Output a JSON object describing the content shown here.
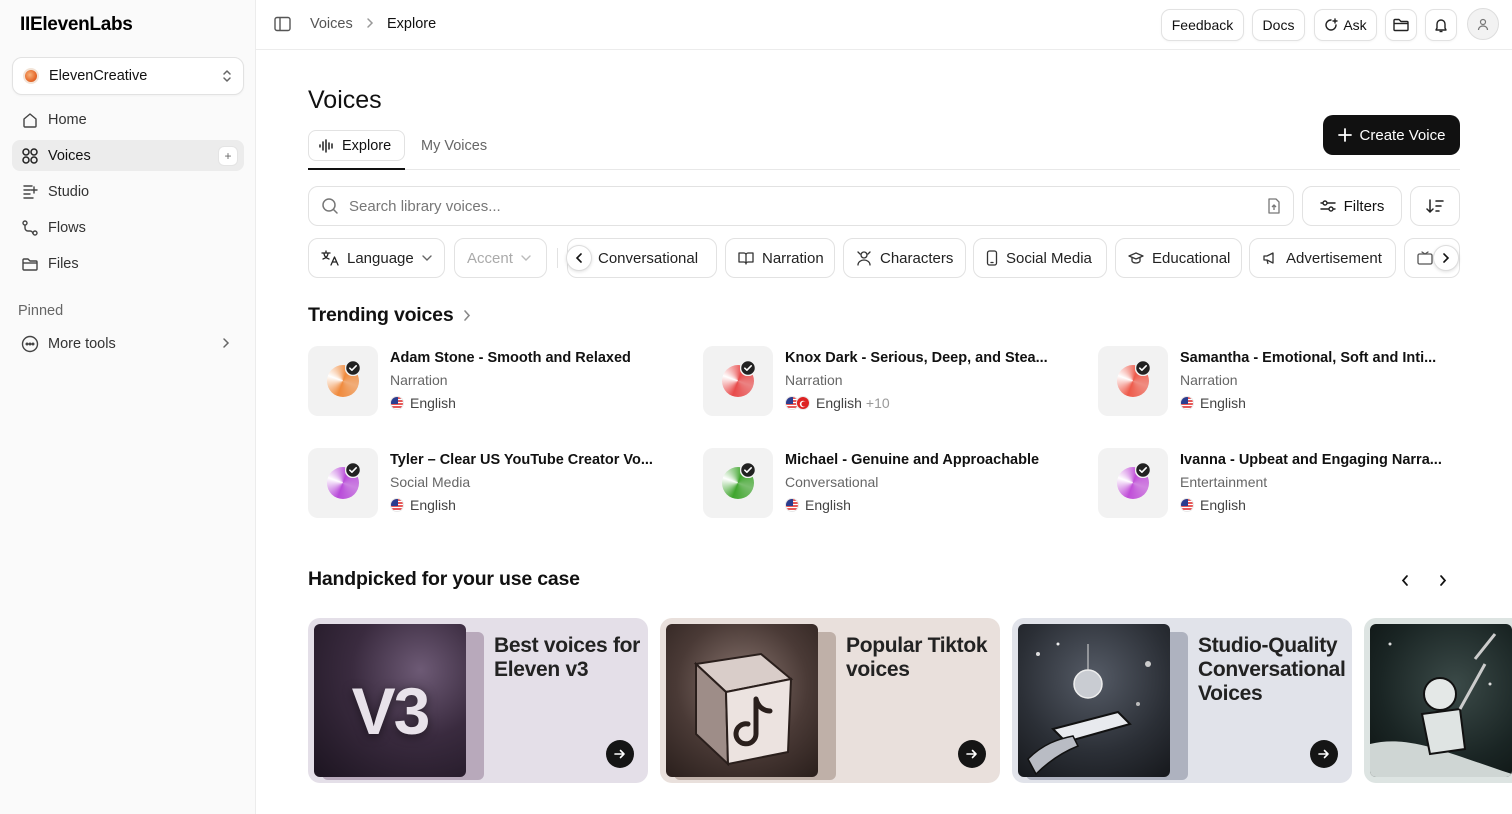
{
  "app": {
    "logo": "IIElevenLabs"
  },
  "sidebar": {
    "workspace": "ElevenCreative",
    "items": [
      {
        "label": "Home",
        "icon": "home-icon"
      },
      {
        "label": "Voices",
        "icon": "voices-grid-icon",
        "active": true
      },
      {
        "label": "Studio",
        "icon": "studio-icon"
      },
      {
        "label": "Flows",
        "icon": "flows-icon"
      },
      {
        "label": "Files",
        "icon": "folder-icon"
      }
    ],
    "pinned_label": "Pinned",
    "more_tools": "More tools"
  },
  "topbar": {
    "breadcrumb": [
      "Voices",
      "Explore"
    ],
    "feedback": "Feedback",
    "docs": "Docs",
    "ask": "Ask"
  },
  "page": {
    "title": "Voices",
    "tabs": [
      {
        "label": "Explore",
        "active": true
      },
      {
        "label": "My Voices",
        "active": false
      }
    ],
    "create_button": "Create Voice",
    "search_placeholder": "Search library voices...",
    "filters_label": "Filters",
    "chips": [
      "Language",
      "Accent",
      "Conversational",
      "Narration",
      "Characters",
      "Social Media",
      "Educational",
      "Advertisement"
    ]
  },
  "trending": {
    "title": "Trending voices",
    "voices": [
      {
        "name": "Adam Stone - Smooth and Relaxed",
        "category": "Narration",
        "language": "English",
        "extra": "",
        "color": "#f08a3c"
      },
      {
        "name": "Knox Dark - Serious, Deep, and Stea...",
        "category": "Narration",
        "language": "English",
        "extra": "+10",
        "color": "#e84b4b"
      },
      {
        "name": "Samantha - Emotional, Soft and Inti...",
        "category": "Narration",
        "language": "English",
        "extra": "",
        "color": "#ee5a4a"
      },
      {
        "name": "Tyler – Clear US YouTube Creator Vo...",
        "category": "Social Media",
        "language": "English",
        "extra": "",
        "color": "#b84ad9"
      },
      {
        "name": "Michael - Genuine and Approachable",
        "category": "Conversational",
        "language": "English",
        "extra": "",
        "color": "#3fa52d"
      },
      {
        "name": "Ivanna - Upbeat and Engaging Narra...",
        "category": "Entertainment",
        "language": "English",
        "extra": "",
        "color": "#c04ed8"
      }
    ]
  },
  "handpicked": {
    "title": "Handpicked for your use case",
    "cards": [
      {
        "title": "Best voices for Eleven v3",
        "bg": "#e4dfe8",
        "art_text": "V3"
      },
      {
        "title": "Popular Tiktok voices",
        "bg": "#e9e0dc"
      },
      {
        "title": "Studio-Quality Conversational Voices",
        "bg": "#e1e3ea"
      },
      {
        "title": "",
        "bg": "#dde4e2"
      }
    ]
  }
}
